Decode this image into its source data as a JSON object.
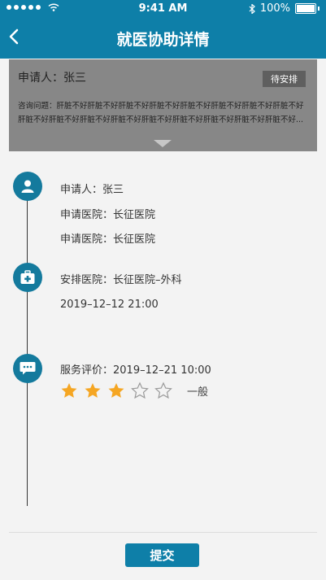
{
  "status_bar": {
    "time": "9:41 AM",
    "battery": "100%"
  },
  "nav": {
    "title": "就医协助详情"
  },
  "summary": {
    "applicant": "申请人：张三",
    "badge": "待安排",
    "question": "咨询问题：肝脏不好肝脏不好肝脏不好肝脏不好肝脏不好肝脏不好肝脏不好肝脏不好肝脏不好肝脏不好肝脏不好肝脏不好肝脏不好肝脏不好肝脏不好肝脏不好肝脏不好..."
  },
  "timeline": {
    "application": {
      "applicant": "申请人：张三",
      "hospital_1": "申请医院：长征医院",
      "hospital_2": "申请医院：长征医院"
    },
    "arrangement": {
      "hospital": "安排医院：长征医院–外科",
      "datetime": "2019–12–12  21:00"
    },
    "evaluation": {
      "label": "服务评价：2019–12–21  10:00",
      "rating": 3,
      "max_rating": 5,
      "rating_text": "一般"
    }
  },
  "submit_label": "提交",
  "colors": {
    "primary": "#0e7fa8",
    "node": "#147a9d",
    "star_filled": "#f5a623",
    "star_empty": "#9a9a9a"
  }
}
